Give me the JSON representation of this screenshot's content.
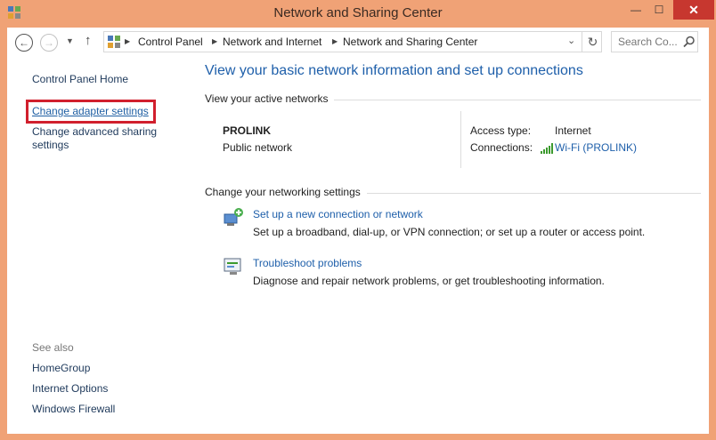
{
  "window": {
    "title": "Network and Sharing Center",
    "min_glyph": "—",
    "max_glyph": "☐",
    "close_glyph": "✕"
  },
  "addressbar": {
    "breadcrumbs": [
      "Control Panel",
      "Network and Internet",
      "Network and Sharing Center"
    ],
    "search_placeholder": "Search Co..."
  },
  "sidebar": {
    "home": "Control Panel Home",
    "change_adapter": "Change adapter settings",
    "change_advanced": "Change advanced sharing settings",
    "see_also_label": "See also",
    "see_also": [
      "HomeGroup",
      "Internet Options",
      "Windows Firewall"
    ]
  },
  "main": {
    "heading": "View your basic network information and set up connections",
    "active_networks_label": "View your active networks",
    "network": {
      "name": "PROLINK",
      "type": "Public network",
      "access_type_label": "Access type:",
      "access_type_value": "Internet",
      "connections_label": "Connections:",
      "connections_value": "Wi-Fi (PROLINK)"
    },
    "change_settings_label": "Change your networking settings",
    "tasks": [
      {
        "icon": "network-setup-icon",
        "link": "Set up a new connection or network",
        "desc": "Set up a broadband, dial-up, or VPN connection; or set up a router or access point."
      },
      {
        "icon": "troubleshoot-icon",
        "link": "Troubleshoot problems",
        "desc": "Diagnose and repair network problems, or get troubleshooting information."
      }
    ]
  },
  "colors": {
    "titlebar": "#f0a276",
    "link": "#1e5faa",
    "highlight": "#d11f2d",
    "close": "#c7372f"
  }
}
